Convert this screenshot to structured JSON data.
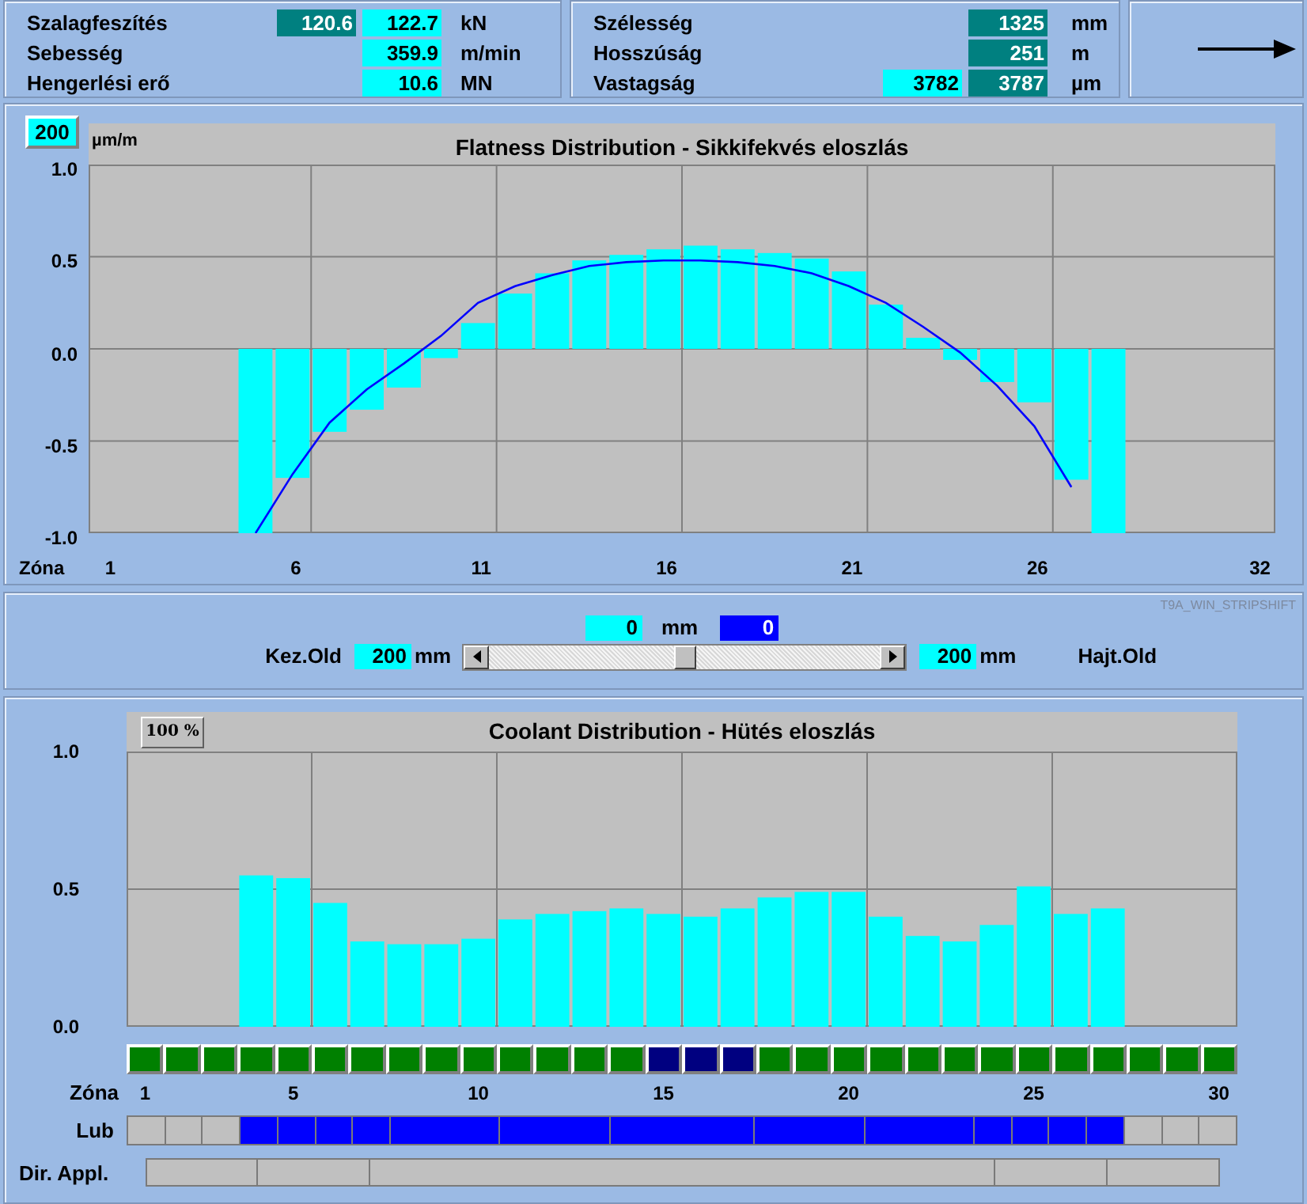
{
  "readouts_left": [
    {
      "label": "Szalagfeszítés",
      "values": [
        {
          "text": "120.6",
          "kind": "actual"
        },
        {
          "text": "122.7",
          "kind": "setpoint"
        }
      ],
      "unit": "kN"
    },
    {
      "label": "Sebesség",
      "values": [
        {
          "text": "359.9",
          "kind": "setpoint"
        }
      ],
      "unit": "m/min"
    },
    {
      "label": "Hengerlési erő",
      "values": [
        {
          "text": "10.6",
          "kind": "setpoint"
        }
      ],
      "unit": "MN"
    }
  ],
  "readouts_right": [
    {
      "label": "Szélesség",
      "values": [
        {
          "text": "1325",
          "kind": "actual"
        }
      ],
      "unit": "mm"
    },
    {
      "label": "Hosszúság",
      "values": [
        {
          "text": "251",
          "kind": "actual"
        }
      ],
      "unit": "m"
    },
    {
      "label": "Vastagság",
      "values": [
        {
          "text": "3782",
          "kind": "setpoint"
        },
        {
          "text": "3787",
          "kind": "actual"
        }
      ],
      "unit": "µm"
    }
  ],
  "flatness": {
    "scale_button": "200",
    "chart_data": {
      "type": "bar",
      "title": "Flatness Distribution - Sikkifekvés eloszlás",
      "xlabel": "Zóna",
      "ylabel": "µm/m",
      "grid": true,
      "x": [
        5,
        6,
        7,
        8,
        9,
        10,
        11,
        12,
        13,
        14,
        15,
        16,
        17,
        18,
        19,
        20,
        21,
        22,
        23,
        24,
        25,
        26,
        27,
        28
      ],
      "xlim": [
        0.5,
        32.5
      ],
      "ylim": [
        -1,
        1
      ],
      "xticks": [
        1,
        6,
        11,
        16,
        21,
        26,
        32
      ],
      "yticks": [
        {
          "value": 1,
          "label": "1.0"
        },
        {
          "value": 0.5,
          "label": "0.5"
        },
        {
          "value": 0,
          "label": "0.0"
        },
        {
          "value": -0.5,
          "label": "-0.5"
        },
        {
          "value": -1,
          "label": "-1.0"
        }
      ],
      "series": [
        {
          "color": "#00ffff",
          "values": [
            -1.0,
            -0.7,
            -0.45,
            -0.33,
            -0.21,
            -0.05,
            0.14,
            0.3,
            0.41,
            0.48,
            0.51,
            0.54,
            0.56,
            0.54,
            0.52,
            0.49,
            0.42,
            0.24,
            0.06,
            -0.06,
            -0.18,
            -0.29,
            -0.71,
            -1.0
          ]
        },
        {
          "type": "line",
          "color": "#0000ff",
          "values": [
            -1.0,
            -0.68,
            -0.4,
            -0.22,
            -0.08,
            0.07,
            0.25,
            0.34,
            0.4,
            0.45,
            0.47,
            0.48,
            0.48,
            0.47,
            0.45,
            0.41,
            0.34,
            0.25,
            0.12,
            -0.02,
            -0.2,
            -0.42,
            -0.75,
            null
          ]
        }
      ]
    }
  },
  "strip_shift": {
    "window_id": "T9A_WIN_STRIPSHIFT",
    "offset_set": "0",
    "offset_unit": "mm",
    "offset_actual": "0",
    "left_label": "Kez.Old",
    "left_value": "200",
    "left_unit": "mm",
    "right_value": "200",
    "right_unit": "mm",
    "right_label": "Hajt.Old",
    "slider": {
      "level": 0.5
    }
  },
  "coolant": {
    "scale_button": "100 %",
    "chart_data": {
      "type": "bar",
      "title": "Coolant Distribution - Hütés eloszlás",
      "xlabel": "Zóna",
      "grid": true,
      "x": [
        4,
        5,
        6,
        7,
        8,
        9,
        10,
        11,
        12,
        13,
        14,
        15,
        16,
        17,
        18,
        19,
        20,
        21,
        22,
        23,
        24,
        25,
        26,
        27
      ],
      "xlim": [
        0.5,
        30.5
      ],
      "ylim": [
        0,
        1
      ],
      "xticks": [
        1,
        5,
        10,
        15,
        20,
        25,
        30
      ],
      "yticks": [
        {
          "value": 1,
          "label": "1.0"
        },
        {
          "value": 0.5,
          "label": "0.5"
        },
        {
          "value": 0,
          "label": "0.0"
        }
      ],
      "series": [
        {
          "color": "#00ffff",
          "values": [
            0.55,
            0.54,
            0.45,
            0.31,
            0.3,
            0.3,
            0.32,
            0.39,
            0.41,
            0.42,
            0.43,
            0.41,
            0.4,
            0.43,
            0.47,
            0.49,
            0.49,
            0.4,
            0.33,
            0.31,
            0.37,
            0.51,
            0.41,
            0.43
          ]
        }
      ]
    },
    "zone_status": [
      {
        "color": "#008000"
      },
      {
        "color": "#008000"
      },
      {
        "color": "#008000"
      },
      {
        "color": "#008000"
      },
      {
        "color": "#008000"
      },
      {
        "color": "#008000"
      },
      {
        "color": "#008000"
      },
      {
        "color": "#008000"
      },
      {
        "color": "#008000"
      },
      {
        "color": "#008000"
      },
      {
        "color": "#008000"
      },
      {
        "color": "#008000"
      },
      {
        "color": "#008000"
      },
      {
        "color": "#008000"
      },
      {
        "color": "#000080"
      },
      {
        "color": "#000080"
      },
      {
        "color": "#000080"
      },
      {
        "color": "#008000"
      },
      {
        "color": "#008000"
      },
      {
        "color": "#008000"
      },
      {
        "color": "#008000"
      },
      {
        "color": "#008000"
      },
      {
        "color": "#008000"
      },
      {
        "color": "#008000"
      },
      {
        "color": "#008000"
      },
      {
        "color": "#008000"
      },
      {
        "color": "#008000"
      },
      {
        "color": "#008000"
      },
      {
        "color": "#008000"
      },
      {
        "color": "#008000"
      }
    ],
    "lub": {
      "label": "Lub",
      "cells": [
        {
          "on": false,
          "joined": false
        },
        {
          "on": false,
          "joined": false
        },
        {
          "on": false,
          "joined": false
        },
        {
          "on": true,
          "joined": false
        },
        {
          "on": true,
          "joined": false
        },
        {
          "on": true,
          "joined": false
        },
        {
          "on": true,
          "joined": false
        },
        {
          "on": true,
          "joined": false
        },
        {
          "on": true,
          "joined": true
        },
        {
          "on": true,
          "joined": true
        },
        {
          "on": true,
          "joined": false
        },
        {
          "on": true,
          "joined": true
        },
        {
          "on": true,
          "joined": true
        },
        {
          "on": true,
          "joined": false
        },
        {
          "on": true,
          "joined": true
        },
        {
          "on": true,
          "joined": true
        },
        {
          "on": true,
          "joined": true
        },
        {
          "on": true,
          "joined": false
        },
        {
          "on": true,
          "joined": true
        },
        {
          "on": true,
          "joined": true
        },
        {
          "on": true,
          "joined": false
        },
        {
          "on": true,
          "joined": true
        },
        {
          "on": true,
          "joined": true
        },
        {
          "on": true,
          "joined": false
        },
        {
          "on": true,
          "joined": false
        },
        {
          "on": true,
          "joined": false
        },
        {
          "on": true,
          "joined": false
        },
        {
          "on": false,
          "joined": false
        },
        {
          "on": false,
          "joined": false
        },
        {
          "on": false,
          "joined": false
        }
      ]
    },
    "dir_appl": {
      "label": "Dir. Appl.",
      "segments": [
        {
          "kind": "narrow"
        },
        {
          "kind": "narrow"
        },
        {
          "kind": "wide"
        },
        {
          "kind": "narrow"
        },
        {
          "kind": "narrow"
        }
      ]
    }
  }
}
